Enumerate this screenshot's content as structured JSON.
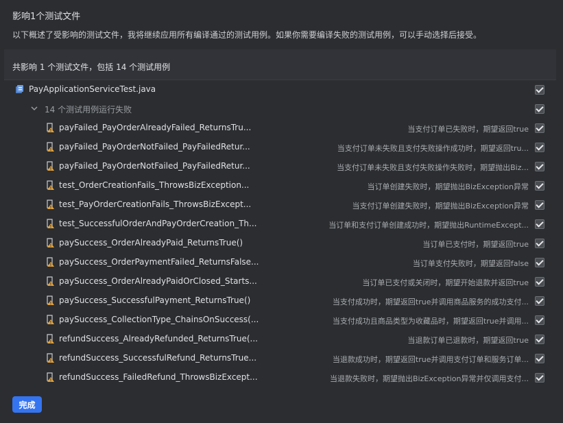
{
  "header": {
    "title": "影响1个测试文件",
    "description": "以下概述了受影响的测试文件，我将继续应用所有编译通过的测试用例。如果你需要编译失败的测试用例，可以手动选择后接受。"
  },
  "summary": "共影响 1 个测试文件，包括 14 个测试用例",
  "file": {
    "name": "PayApplicationServiceTest.java",
    "icon": "java-test-file-icon",
    "checked": true
  },
  "group": {
    "label": "14 个测试用例运行失败",
    "checked": true
  },
  "tests": [
    {
      "name": "payFailed_PayOrderAlreadyFailed_ReturnsTru...",
      "desc": "当支付订单已失败时，期望返回true"
    },
    {
      "name": "payFailed_PayOrderNotFailed_PayFailedRetur...",
      "desc": "当支付订单未失败且支付失败操作成功时，期望返回tru..."
    },
    {
      "name": "payFailed_PayOrderNotFailed_PayFailedRetur...",
      "desc": "当支付订单未失败且支付失败操作失败时，期望抛出Biz..."
    },
    {
      "name": "test_OrderCreationFails_ThrowsBizException...",
      "desc": "当订单创建失败时，期望抛出BizException异常"
    },
    {
      "name": "test_PayOrderCreationFails_ThrowsBizExcept...",
      "desc": "当支付订单创建失败时，期望抛出BizException异常"
    },
    {
      "name": "test_SuccessfulOrderAndPayOrderCreation_Th...",
      "desc": "当订单和支付订单创建成功时，期望抛出RuntimeExcept..."
    },
    {
      "name": "paySuccess_OrderAlreadyPaid_ReturnsTrue()",
      "desc": "当订单已支付时，期望返回true"
    },
    {
      "name": "paySuccess_OrderPaymentFailed_ReturnsFalse...",
      "desc": "当订单支付失败时，期望返回false"
    },
    {
      "name": "paySuccess_OrderAlreadyPaidOrClosed_Starts...",
      "desc": "当订单已支付或关闭时，期望开始退款并返回true"
    },
    {
      "name": "paySuccess_SuccessfulPayment_ReturnsTrue()",
      "desc": "当支付成功时，期望返回true并调用商品服务的成功支付..."
    },
    {
      "name": "paySuccess_CollectionType_ChainsOnSuccess(...",
      "desc": "当支付成功且商品类型为收藏品时，期望返回true并调用..."
    },
    {
      "name": "refundSuccess_AlreadyRefunded_ReturnsTrue(...",
      "desc": "当退款订单已退款时，期望返回true"
    },
    {
      "name": "refundSuccess_SuccessfulRefund_ReturnsTrue...",
      "desc": "当退款成功时，期望返回true并调用支付订单和服务订单..."
    },
    {
      "name": "refundSuccess_FailedRefund_ThrowsBizExcept...",
      "desc": "当退款失败时，期望抛出BizException异常并仅调用支付..."
    }
  ],
  "footer": {
    "done_label": "完成"
  },
  "colors": {
    "accent": "#3574f0",
    "background": "#2b2d30",
    "warning_icon": "#e5a33b"
  }
}
